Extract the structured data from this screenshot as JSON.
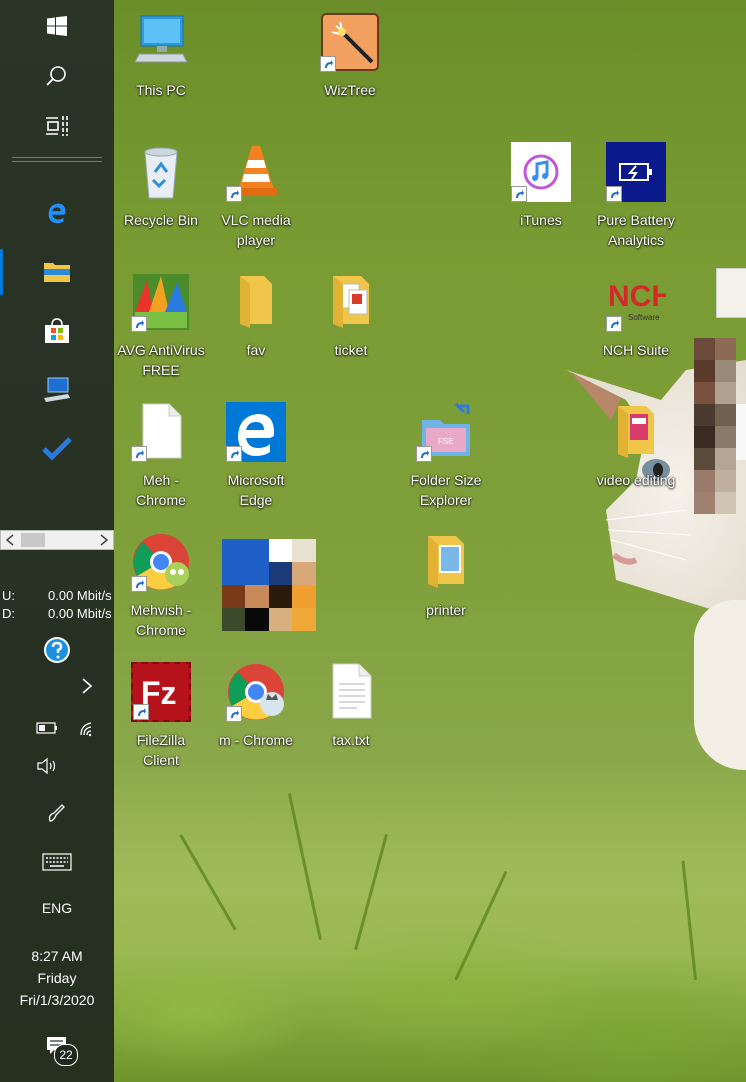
{
  "desktop": {
    "icons": {
      "this_pc": "This PC",
      "wiztree": "WizTree",
      "recycle_bin": "Recycle Bin",
      "vlc_line1": "VLC media",
      "vlc_line2": "player",
      "itunes": "iTunes",
      "pure_battery_line1": "Pure Battery",
      "pure_battery_line2": "Analytics",
      "avg_line1": "AVG AntiVirus",
      "avg_line2": "FREE",
      "fav": "fav",
      "ticket": "ticket",
      "nch_suite": "NCH Suite",
      "meh_line1": "Meh -",
      "meh_line2": "Chrome",
      "edge_line1": "Microsoft",
      "edge_line2": "Edge",
      "folder_size_line1": "Folder Size",
      "folder_size_line2": "Explorer",
      "video_editing": "video editing",
      "mehvish_line1": "Mehvish -",
      "mehvish_line2": "Chrome",
      "printer": "printer",
      "filezilla_line1": "FileZilla",
      "filezilla_line2": "Client",
      "m_chrome": "m - Chrome",
      "tax": "tax.txt"
    },
    "nch_badge_text": "NCH",
    "nch_badge_sub": "Software",
    "folder_size_badge": "FSE",
    "filezilla_badge": "Fz"
  },
  "taskbar": {
    "network": {
      "upload_label": "U:",
      "upload_value": "0.00 Mbit/s",
      "download_label": "D:",
      "download_value": "0.00 Mbit/s"
    },
    "language": "ENG",
    "time": "8:27 AM",
    "day": "Friday",
    "date": "Fri/1/3/2020",
    "notification_count": "22"
  },
  "colors": {
    "accent_blue": "#0078d7",
    "taskbar_bg": "#273124"
  }
}
